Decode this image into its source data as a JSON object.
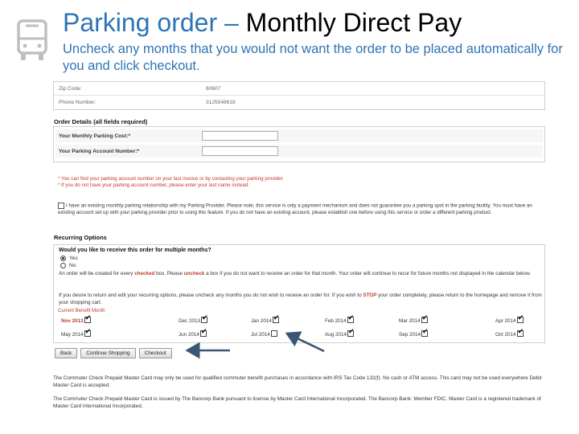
{
  "slide": {
    "title_part1": "Parking order –",
    "title_part2": " Monthly Direct Pay",
    "subtitle": "Uncheck any months that you would not want the order to be placed automatically for you and click checkout."
  },
  "address": {
    "rows": [
      {
        "label": "Zip Code:",
        "value": "60607"
      },
      {
        "label": "Phone Number:",
        "value": "3125548618"
      }
    ]
  },
  "order_details": {
    "heading": "Order Details (all fields required)",
    "fields": [
      {
        "label": "Your Monthly Parking Cost:*",
        "value": ""
      },
      {
        "label": "Your Parking Account Number:*",
        "value": ""
      }
    ],
    "note1": "* You can find your parking account number on your last invoice or by contacting your parking provider.",
    "note2": "* If you do not have your parking account number, please enter your last name instead.",
    "agreement": "I have an existing monthly parking relationship with my Parking Provider. Please note, this service is only a payment mechanism and does not guarantee you a parking spot in the parking facility. You must have an existing account set up with your parking provider prior to using this feature. If you do not have an existing account, please establish one before using this service or order a different parking product."
  },
  "recurring": {
    "heading": "Recurring Options",
    "question": "Would you like to receive this order for multiple months?",
    "options": [
      "Yes",
      "No"
    ],
    "selected": "Yes",
    "para1_a": "An order will be created for every ",
    "para1_b": "checked",
    "para1_c": " box. Please ",
    "para1_d": "uncheck",
    "para1_e": " a box if you do not want to receive an order for that month. Your order will continue to recur for future months not displayed in the calendar below.",
    "para2_a": "If you desire to return and edit your recurring options, please uncheck any months you do not wish to receive an order for. If you wish to ",
    "para2_b": "STOP",
    "para2_c": " your order completely, please return to the homepage and remove it from your shopping cart.",
    "calendar_label": "Current Benefit Month",
    "months": [
      {
        "label": "Nov 2013",
        "checked": true
      },
      {
        "label": "Dec 2013",
        "checked": true
      },
      {
        "label": "Jan 2014",
        "checked": true
      },
      {
        "label": "Feb 2014",
        "checked": true
      },
      {
        "label": "Mar 2014",
        "checked": true
      },
      {
        "label": "Apr 2014",
        "checked": true
      },
      {
        "label": "May 2014",
        "checked": true
      },
      {
        "label": "Jun 2014",
        "checked": true
      },
      {
        "label": "Jul 2014",
        "checked": false
      },
      {
        "label": "Aug 2014",
        "checked": true
      },
      {
        "label": "Sep 2014",
        "checked": true
      },
      {
        "label": "Oct 2014",
        "checked": true
      }
    ]
  },
  "buttons": {
    "back": "Back",
    "continue": "Continue Shopping",
    "checkout": "Checkout"
  },
  "footer": {
    "text1": "The Commuter Check Prepaid Master Card may only be used for qualified commuter benefit purchases in accordance with IRS Tax Code 132(f). No cash or ATM access. This card may not be used everywhere Debit Master Card is accepted.",
    "text2": "The Commuter Check Prepaid Master Card is issued by The Bancorp Bank pursuant to license by Master Card International Incorporated. The Bancorp Bank: Member FDIC. Master Card is a registered trademark of Master Card International Incorporated."
  },
  "colors": {
    "title_accent": "#2e74b5",
    "arrow": "#3a5673",
    "notice_red": "#c0392b"
  },
  "icons": {
    "slide_icon": "bus-icon"
  }
}
